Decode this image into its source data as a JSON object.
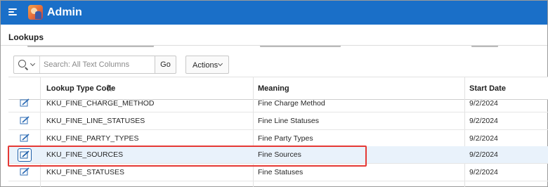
{
  "app": {
    "title": "Admin"
  },
  "region": {
    "title": "Lookups"
  },
  "toolbar": {
    "search_placeholder": "Search: All Text Columns",
    "go_label": "Go",
    "actions_label": "Actions"
  },
  "grid": {
    "columns": {
      "code": "Lookup Type Code",
      "meaning": "Meaning",
      "start_date": "Start Date"
    },
    "sorted_column": "Lookup Type Code",
    "sort_direction": "ascending",
    "rows": [
      {
        "code": "KKU_FINE_CHARGE_METHOD",
        "meaning": "Fine Charge Method",
        "start_date": "9/2/2024"
      },
      {
        "code": "KKU_FINE_LINE_STATUSES",
        "meaning": "Fine Line Statuses",
        "start_date": "9/2/2024"
      },
      {
        "code": "KKU_FINE_PARTY_TYPES",
        "meaning": "Fine Party Types",
        "start_date": "9/2/2024"
      },
      {
        "code": "KKU_FINE_SOURCES",
        "meaning": "Fine Sources",
        "start_date": "9/2/2024",
        "selected": true
      },
      {
        "code": "KKU_FINE_STATUSES",
        "meaning": "Fine Statuses",
        "start_date": "9/2/2024"
      }
    ]
  },
  "colors": {
    "header_bar": "#1a6fc8",
    "selected_row": "#e9f2fb",
    "highlight_border": "#e53935",
    "edit_icon": "#2f6db5"
  },
  "icons": {
    "menu": "hamburger-menu-icon",
    "search": "search-icon",
    "row_edit": "pencil-edit-icon",
    "sort": "sort-ascending-icon"
  }
}
